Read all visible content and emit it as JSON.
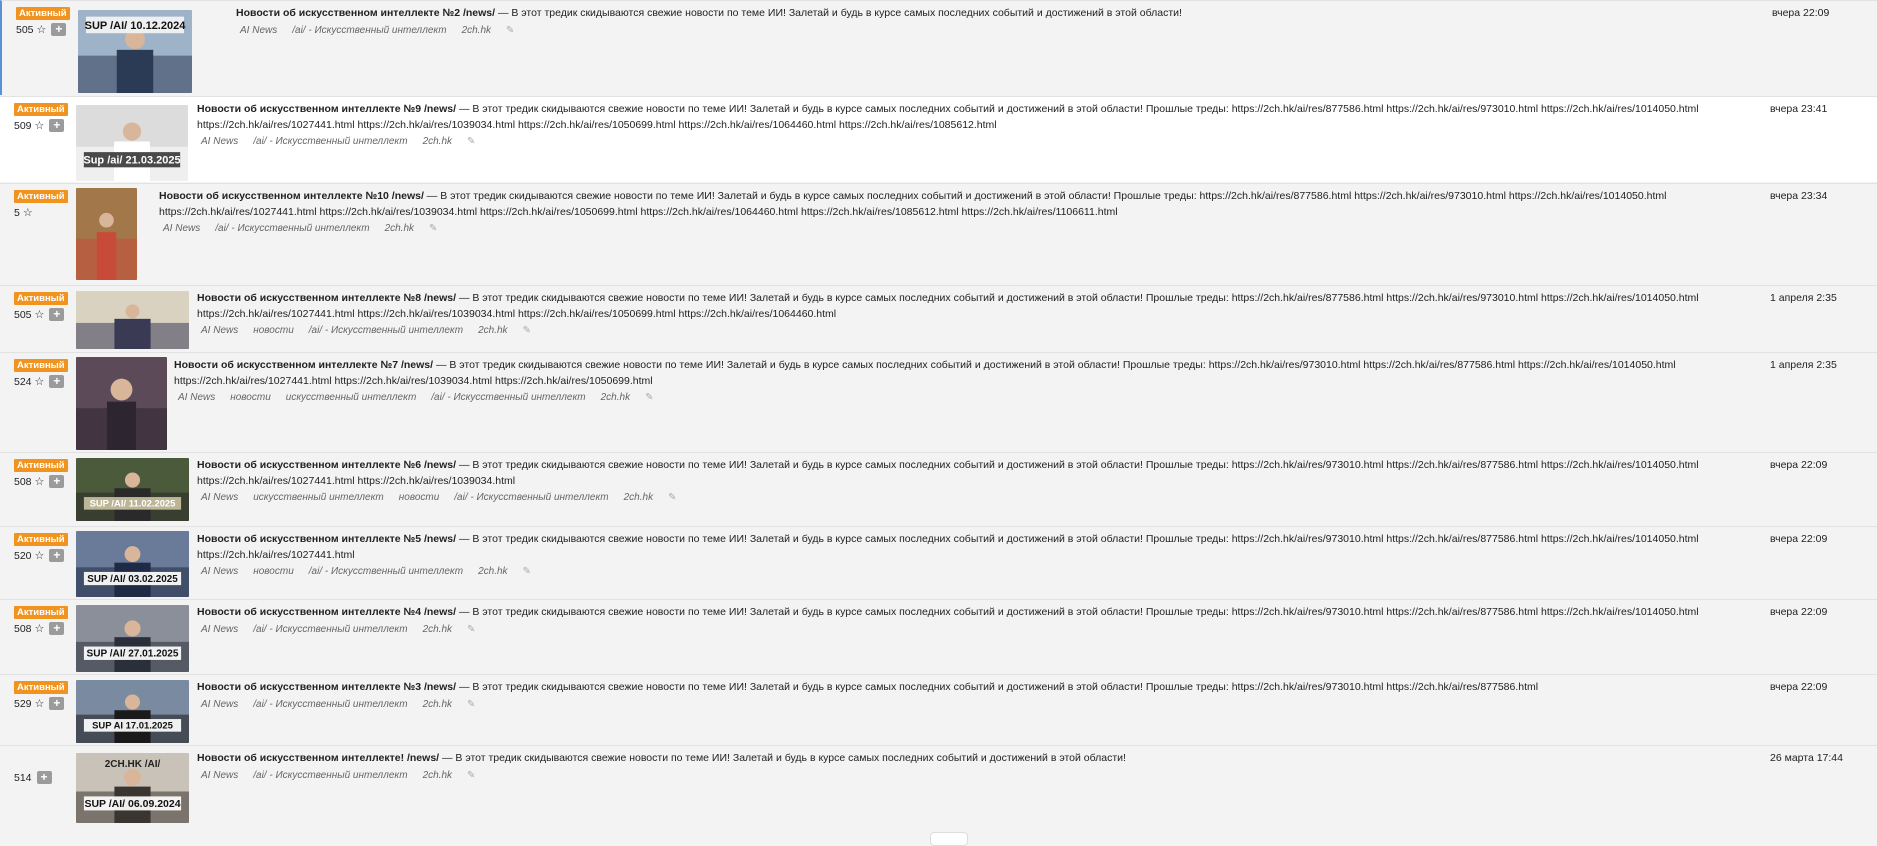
{
  "threads": [
    {
      "status": "Активный",
      "rating": "505",
      "time": "вчера 22:09",
      "title": "Новости об искусственном интеллекте №2 /news/",
      "text": " — В этот тредик скидываются свежие новости по теме ИИ! Залетай и будь в курсе самых последних событий и достижений в этой области!",
      "tags": [
        "AI News",
        "/ai/ - Искусственный интеллект",
        "2ch.hk"
      ],
      "thumb_caption": "SUP /AI/ 10.12.2024"
    },
    {
      "status": "Активный",
      "rating": "509",
      "time": "вчера 23:41",
      "title": "Новости об искусственном интеллекте №9 /news/",
      "text": " — В этот тредик скидываются свежие новости по теме ИИ! Залетай и будь в курсе самых последних событий и достижений в этой области! Прошлые треды: https://2ch.hk/ai/res/877586.html https://2ch.hk/ai/res/973010.html https://2ch.hk/ai/res/1014050.html https://2ch.hk/ai/res/1027441.html https://2ch.hk/ai/res/1039034.html https://2ch.hk/ai/res/1050699.html https://2ch.hk/ai/res/1064460.html https://2ch.hk/ai/res/1085612.html",
      "tags": [
        "AI News",
        "/ai/ - Искусственный интеллект",
        "2ch.hk"
      ],
      "thumb_caption": "Sup /ai/ 21.03.2025"
    },
    {
      "status": "Активный",
      "rating": "5",
      "time": "вчера 23:34",
      "title": "Новости об искусственном интеллекте №10 /news/",
      "text": " — В этот тредик скидываются свежие новости по теме ИИ! Залетай и будь в курсе самых последних событий и достижений в этой области! Прошлые треды: https://2ch.hk/ai/res/877586.html https://2ch.hk/ai/res/973010.html https://2ch.hk/ai/res/1014050.html https://2ch.hk/ai/res/1027441.html https://2ch.hk/ai/res/1039034.html https://2ch.hk/ai/res/1050699.html https://2ch.hk/ai/res/1064460.html https://2ch.hk/ai/res/1085612.html https://2ch.hk/ai/res/1106611.html",
      "tags": [
        "AI News",
        "/ai/ - Искусственный интеллект",
        "2ch.hk"
      ],
      "thumb_caption": ""
    },
    {
      "status": "Активный",
      "rating": "505",
      "time": "1 апреля 2:35",
      "title": "Новости об искусственном интеллекте №8 /news/",
      "text": " — В этот тредик скидываются свежие новости по теме ИИ! Залетай и будь в курсе самых последних событий и достижений в этой области! Прошлые треды: https://2ch.hk/ai/res/877586.html https://2ch.hk/ai/res/973010.html https://2ch.hk/ai/res/1014050.html https://2ch.hk/ai/res/1027441.html https://2ch.hk/ai/res/1039034.html https://2ch.hk/ai/res/1050699.html https://2ch.hk/ai/res/1064460.html",
      "tags": [
        "AI News",
        "новости",
        "/ai/ - Искусственный интеллект",
        "2ch.hk"
      ],
      "thumb_caption": ""
    },
    {
      "status": "Активный",
      "rating": "524",
      "time": "1 апреля 2:35",
      "title": "Новости об искусственном интеллекте №7 /news/",
      "text": " — В этот тредик скидываются свежие новости по теме ИИ! Залетай и будь в курсе самых последних событий и достижений в этой области! Прошлые треды: https://2ch.hk/ai/res/973010.html https://2ch.hk/ai/res/877586.html https://2ch.hk/ai/res/1014050.html https://2ch.hk/ai/res/1027441.html https://2ch.hk/ai/res/1039034.html https://2ch.hk/ai/res/1050699.html",
      "tags": [
        "AI News",
        "новости",
        "искусственный интеллект",
        "/ai/ - Искусственный интеллект",
        "2ch.hk"
      ],
      "thumb_caption": ""
    },
    {
      "status": "Активный",
      "rating": "508",
      "time": "вчера 22:09",
      "title": "Новости об искусственном интеллекте №6 /news/",
      "text": " — В этот тредик скидываются свежие новости по теме ИИ! Залетай и будь в курсе самых последних событий и достижений в этой области! Прошлые треды: https://2ch.hk/ai/res/973010.html https://2ch.hk/ai/res/877586.html https://2ch.hk/ai/res/1014050.html https://2ch.hk/ai/res/1027441.html https://2ch.hk/ai/res/1039034.html",
      "tags": [
        "AI News",
        "искусственный интеллект",
        "новости",
        "/ai/ - Искусственный интеллект",
        "2ch.hk"
      ],
      "thumb_caption": "SUP /AI/ 11.02.2025"
    },
    {
      "status": "Активный",
      "rating": "520",
      "time": "вчера 22:09",
      "title": "Новости об искусственном интеллекте №5 /news/",
      "text": " — В этот тредик скидываются свежие новости по теме ИИ! Залетай и будь в курсе самых последних событий и достижений в этой области! Прошлые треды: https://2ch.hk/ai/res/973010.html https://2ch.hk/ai/res/877586.html https://2ch.hk/ai/res/1014050.html https://2ch.hk/ai/res/1027441.html",
      "tags": [
        "AI News",
        "новости",
        "/ai/ - Искусственный интеллект",
        "2ch.hk"
      ],
      "thumb_caption": "SUP /AI/ 03.02.2025"
    },
    {
      "status": "Активный",
      "rating": "508",
      "time": "вчера 22:09",
      "title": "Новости об искусственном интеллекте №4 /news/",
      "text": " — В этот тредик скидываются свежие новости по теме ИИ! Залетай и будь в курсе самых последних событий и достижений в этой области! Прошлые треды: https://2ch.hk/ai/res/973010.html https://2ch.hk/ai/res/877586.html https://2ch.hk/ai/res/1014050.html",
      "tags": [
        "AI News",
        "/ai/ - Искусственный интеллект",
        "2ch.hk"
      ],
      "thumb_caption": "SUP /AI/ 27.01.2025"
    },
    {
      "status": "Активный",
      "rating": "529",
      "time": "вчера 22:09",
      "title": "Новости об искусственном интеллекте №3 /news/",
      "text": " — В этот тредик скидываются свежие новости по теме ИИ! Залетай и будь в курсе самых последних событий и достижений в этой области! Прошлые треды: https://2ch.hk/ai/res/973010.html https://2ch.hk/ai/res/877586.html",
      "tags": [
        "AI News",
        "/ai/ - Искусственный интеллект",
        "2ch.hk"
      ],
      "thumb_caption": "SUP AI 17.01.2025"
    },
    {
      "status": "",
      "rating": "514",
      "time": "26 марта 17:44",
      "title": "Новости об искусственном интеллекте! /news/",
      "text": " — В этот тредик скидываются свежие новости по теме ИИ! Залетай и будь в курсе самых последних событий и достижений в этой области!",
      "tags": [
        "AI News",
        "/ai/ - Искусственный интеллект",
        "2ch.hk"
      ],
      "thumb_caption": "SUP /AI/ 06.09.2024",
      "thumb_caption_top": "2CH.HK /AI/"
    }
  ],
  "icons": {
    "star": "star-icon",
    "plus": "plus-icon",
    "edit": "edit-icon"
  }
}
